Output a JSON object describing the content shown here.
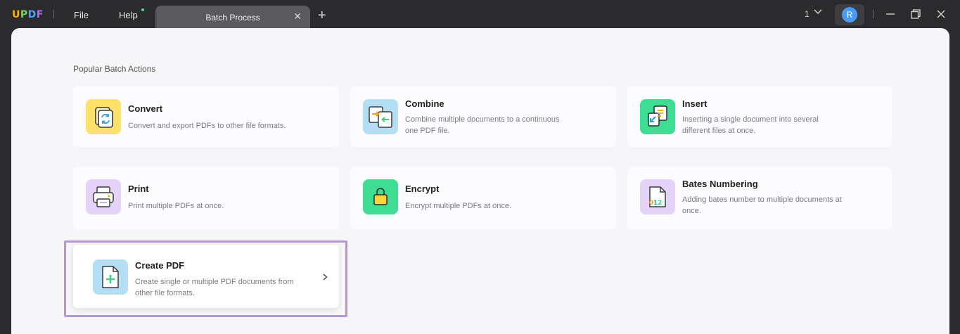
{
  "app": {
    "logo": [
      "U",
      "P",
      "D",
      "F"
    ],
    "menu": {
      "file": "File",
      "help": "Help"
    },
    "tab": {
      "label": "Batch Process",
      "close": "✕"
    },
    "new_tab": "+",
    "page_count": "1",
    "avatar_initial": "R"
  },
  "main": {
    "section_title": "Popular Batch Actions",
    "cards": [
      {
        "title": "Convert",
        "desc": [
          "Convert and export PDFs to other file formats."
        ],
        "icon": "convert-icon",
        "color": "#fde16b"
      },
      {
        "title": "Combine",
        "desc": [
          "Combine multiple documents to a continuous",
          "one PDF file."
        ],
        "icon": "combine-icon",
        "color": "#b4def4"
      },
      {
        "title": "Insert",
        "desc": [
          "Inserting a single document into several",
          "different files at once."
        ],
        "icon": "insert-icon",
        "color": "#3fdc93"
      },
      {
        "title": "Print",
        "desc": [
          "Print multiple PDFs at once."
        ],
        "icon": "print-icon",
        "color": "#e4d2f8"
      },
      {
        "title": "Encrypt",
        "desc": [
          "Encrypt multiple PDFs at once."
        ],
        "icon": "lock-icon",
        "color": "#3fdc93"
      },
      {
        "title": "Bates Numbering",
        "desc": [
          "Adding bates number to multiple documents at",
          "once."
        ],
        "icon": "bates-number-icon",
        "color": "#e4d2f8"
      },
      {
        "title": "Create PDF",
        "desc": [
          "Create single or multiple PDF documents from",
          "other file formats."
        ],
        "icon": "create-pdf-icon",
        "color": "#b4def4"
      }
    ]
  },
  "colors": {
    "highlight": "#b594e0",
    "accent_green": "#3fdc93",
    "avatar": "#4a9cf2"
  }
}
